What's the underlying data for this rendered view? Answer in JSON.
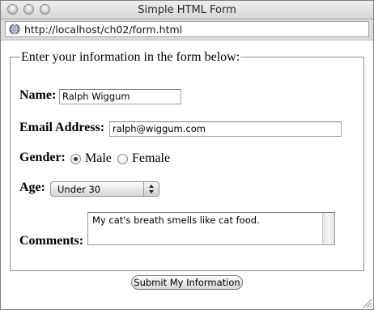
{
  "window": {
    "title": "Simple HTML Form",
    "url": "http://localhost/ch02/form.html"
  },
  "form": {
    "legend": "Enter your information in the form below:",
    "name": {
      "label": "Name:",
      "value": "Ralph Wiggum"
    },
    "email": {
      "label": "Email Address:",
      "value": "ralph@wiggum.com"
    },
    "gender": {
      "label": "Gender:",
      "options": [
        {
          "label": "Male",
          "selected": true
        },
        {
          "label": "Female",
          "selected": false
        }
      ]
    },
    "age": {
      "label": "Age:",
      "selected": "Under 30"
    },
    "comments": {
      "label": "Comments:",
      "value": "My cat's breath smells like cat food."
    },
    "submit_label": "Submit My Information"
  },
  "icons": {
    "window_controls": [
      "close-icon",
      "minimize-icon",
      "zoom-icon"
    ],
    "address": "globe-icon",
    "select_arrows": "up-down-arrows-icon",
    "resize": "resize-grip-icon"
  }
}
